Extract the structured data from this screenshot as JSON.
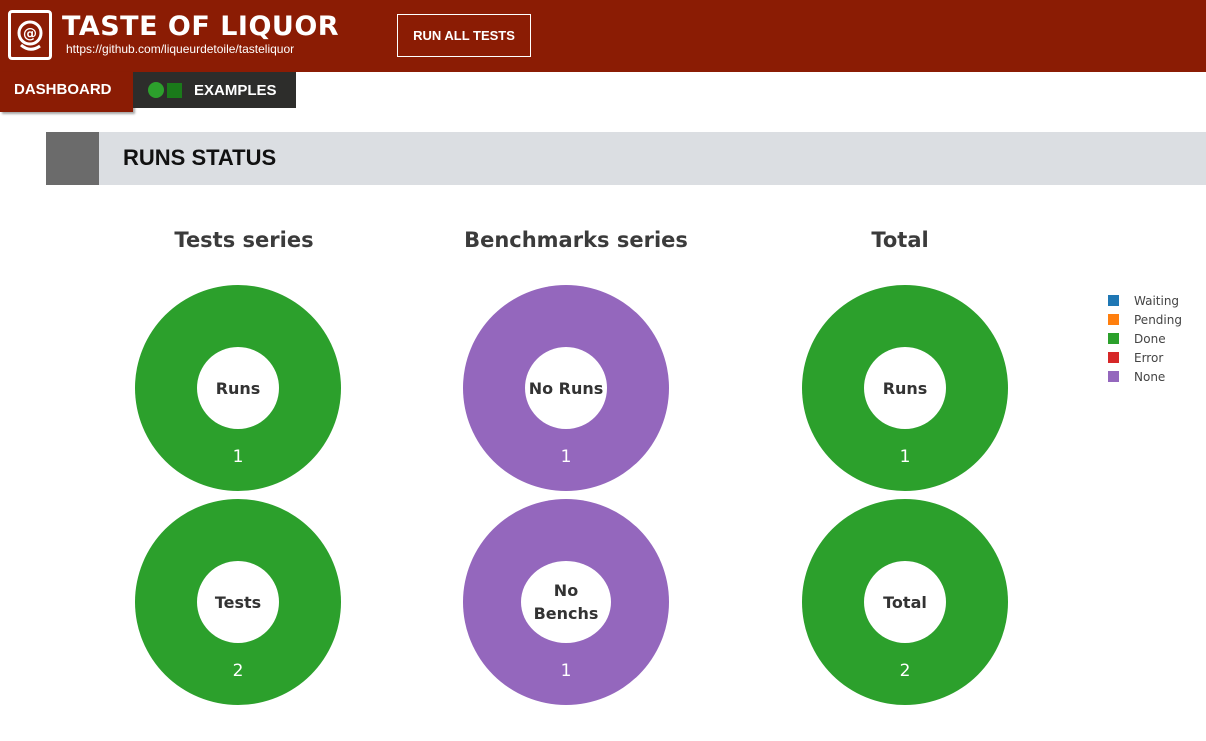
{
  "header": {
    "title": "TASTE OF LIQUOR",
    "subtitle": "https://github.com/liqueurdetoile/tasteliquor",
    "run_button": "RUN ALL TESTS",
    "bg_color": "#8b1c04"
  },
  "tabs": {
    "dashboard": "DASHBOARD",
    "examples": "EXAMPLES",
    "examples_dot_color": "#2ca02c",
    "examples_square_color": "#1a7a1a"
  },
  "section": {
    "title": "RUNS STATUS"
  },
  "columns": [
    {
      "title": "Tests series",
      "donuts": [
        {
          "center_label": "Runs",
          "value": "1",
          "color": "#2ca02c",
          "status": "Done"
        },
        {
          "center_label": "Tests",
          "value": "2",
          "color": "#2ca02c",
          "status": "Done"
        }
      ]
    },
    {
      "title": "Benchmarks series",
      "donuts": [
        {
          "center_label": "No Runs",
          "value": "1",
          "color": "#9467bd",
          "status": "None"
        },
        {
          "center_label": "No Benchs",
          "value": "1",
          "color": "#9467bd",
          "status": "None"
        }
      ]
    },
    {
      "title": "Total",
      "donuts": [
        {
          "center_label": "Runs",
          "value": "1",
          "color": "#2ca02c",
          "status": "Done"
        },
        {
          "center_label": "Total",
          "value": "2",
          "color": "#2ca02c",
          "status": "Done"
        }
      ]
    }
  ],
  "legend": [
    {
      "label": "Waiting",
      "color": "#1f77b4"
    },
    {
      "label": "Pending",
      "color": "#ff7f0e"
    },
    {
      "label": "Done",
      "color": "#2ca02c"
    },
    {
      "label": "Error",
      "color": "#d62728"
    },
    {
      "label": "None",
      "color": "#9467bd"
    }
  ]
}
